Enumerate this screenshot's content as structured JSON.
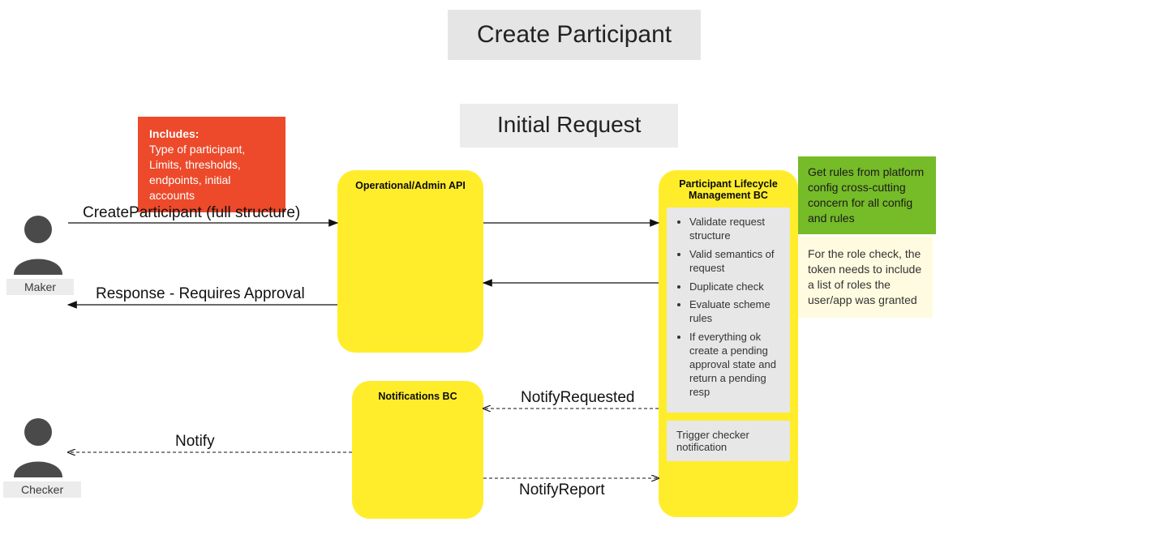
{
  "title": "Create Participant",
  "subtitle": "Initial Request",
  "actors": {
    "maker": "Maker",
    "checker": "Checker"
  },
  "notes": {
    "includes_label": "Includes:",
    "includes_body": "Type of participant, Limits, thresholds, endpoints, initial accounts",
    "green": "Get rules from platform config cross-cutting concern for all config and rules",
    "yellow": "For the role check, the token needs to include a list of roles the user/app was granted"
  },
  "blocks": {
    "api": "Operational/Admin API",
    "plm": "Participant Lifecycle Management BC",
    "notifications": "Notifications BC"
  },
  "plm_steps": [
    "Validate request structure",
    "Valid semantics of request",
    "Duplicate check",
    "Evaluate scheme rules",
    "If everything ok create a pending approval state and return a pending resp"
  ],
  "plm_trigger": "Trigger checker notification",
  "messages": {
    "create": "CreateParticipant (full structure)",
    "response": "Response - Requires Approval",
    "notify_requested": "NotifyRequested",
    "notify": "Notify",
    "notify_report": "NotifyReport"
  }
}
